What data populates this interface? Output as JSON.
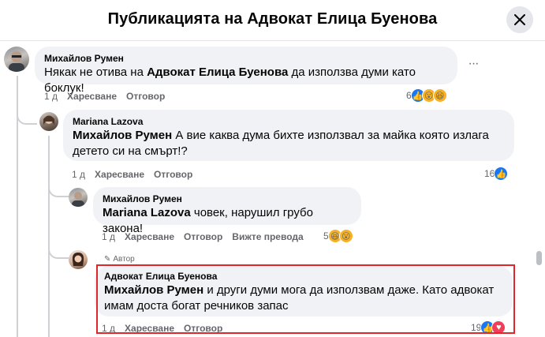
{
  "header": {
    "title": "Публикацията на Адвокат Елица Буенова"
  },
  "comments": [
    {
      "author": "Михайлов Румен",
      "text": "Някак не отива на ",
      "bold_part": "Адвокат Елица Буенова",
      "text_after": " да използва думи като боклук!",
      "time": "1 д",
      "like": "Харесване",
      "reply": "Отговор",
      "reactions": "6"
    },
    {
      "author": "Mariana Lazova",
      "mention": "Михайлов Румен",
      "text": " А вие каква дума бихте използвал за майка която излага детето си на смърт!?",
      "time": "1 д",
      "like": "Харесване",
      "reply": "Отговор",
      "reactions": "16"
    },
    {
      "author": "Михайлов Румен",
      "mention": "Mariana Lazova",
      "text": " човек, нарушил грубо закона!",
      "time": "1 д",
      "like": "Харесване",
      "reply": "Отговор",
      "translate": "Вижте превода",
      "reactions": "5"
    },
    {
      "badge": "Автор",
      "author": "Адвокат Елица Буенова",
      "mention": "Михайлов Румен",
      "text": " и други думи мога да използвам даже. Като адвокат имам доста богат речников запас",
      "time": "1 д",
      "like": "Харесване",
      "reply": "Отговор",
      "reactions": "19"
    }
  ],
  "icons": {
    "close": "close-icon",
    "more": "more-options-icon",
    "like": "like-reaction-icon",
    "wow": "wow-reaction-icon",
    "haha": "haha-reaction-icon",
    "love": "love-reaction-icon"
  },
  "colors": {
    "link_blue": "#1877f2",
    "highlight_red": "#e0252b",
    "bubble_bg": "#f0f2f5"
  }
}
